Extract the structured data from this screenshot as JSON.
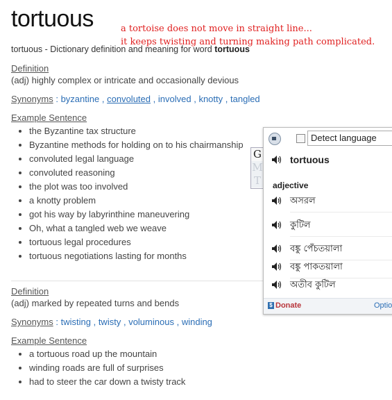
{
  "page": {
    "word": "tortuous",
    "subtitle_prefix": "tortuous - Dictionary definition and meaning for word ",
    "subtitle_word": "tortuous"
  },
  "annotation": {
    "line1": "a tortoise does not move in straight line...",
    "line2": "it keeps twisting and turning making path complicated."
  },
  "entries": [
    {
      "definition_heading": "Definition",
      "definition": "(adj) highly complex or intricate and occasionally devious",
      "synonyms_label": "Synonyms",
      "synonyms": [
        "byzantine",
        "convoluted",
        "involved",
        "knotty",
        "tangled"
      ],
      "example_heading": "Example Sentence",
      "examples": [
        "the Byzantine tax structure",
        "Byzantine methods for holding on to his chairmanship",
        "convoluted legal language",
        "convoluted reasoning",
        "the plot was too involved",
        "a knotty problem",
        "got his way by labyrinthine maneuvering",
        "Oh, what a tangled web we weave",
        "tortuous legal procedures",
        "tortuous negotiations lasting for months"
      ]
    },
    {
      "definition_heading": "Definition",
      "definition": "(adj) marked by repeated turns and bends",
      "synonyms_label": "Synonyms",
      "synonyms": [
        "twisting",
        "twisty",
        "voluminous",
        "winding"
      ],
      "example_heading": "Example Sentence",
      "examples": [
        "a tortuous road up the mountain",
        "winding roads are full of surprises",
        "had to steer the car down a twisty track"
      ]
    }
  ],
  "translator": {
    "language_select": "Detect language",
    "word": "tortuous",
    "part_of_speech": "adjective",
    "translations": [
      "অসরল",
      "কুটিল",
      "বঙ্কু পেঁচতয়ালা",
      "বঙ্কু পাকতয়ালা",
      "অতীব কুটিল"
    ],
    "donate_label": "Donate",
    "options_label": "Optio",
    "side_tabs": [
      "G",
      "M",
      "T"
    ],
    "icons": [
      "speaker-icon",
      "checkbox",
      "dropdown-caret",
      "donate-icon"
    ]
  }
}
